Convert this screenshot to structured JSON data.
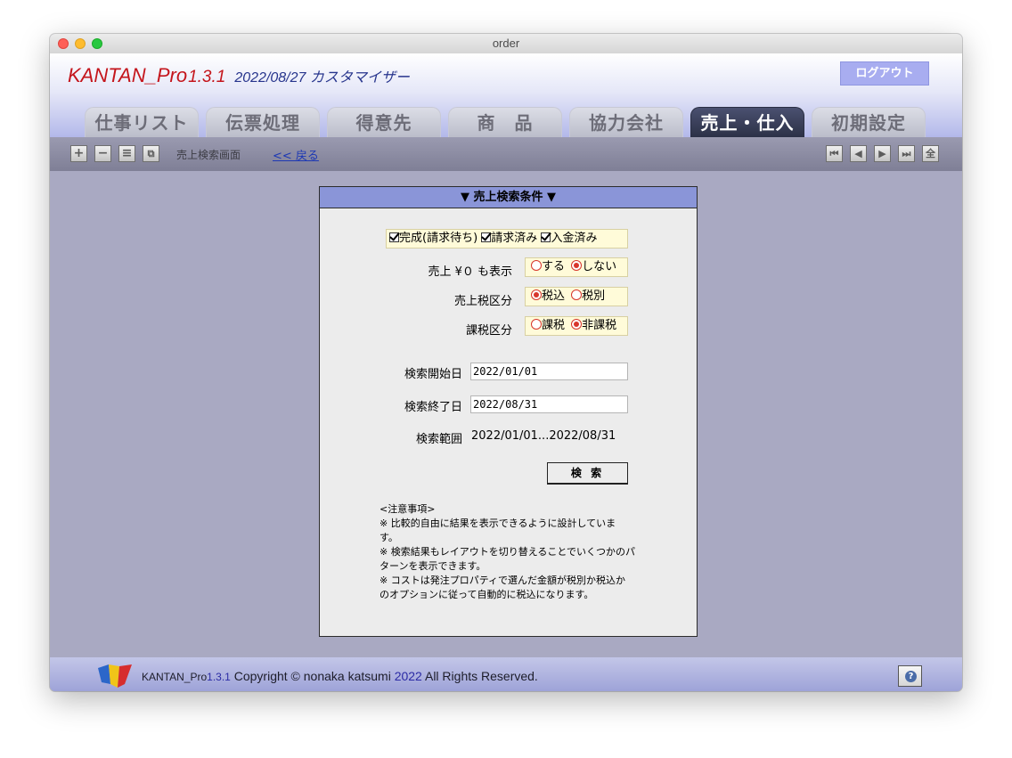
{
  "window": {
    "title": "order"
  },
  "header": {
    "app_name": "KANTAN_Pro",
    "app_version": "1.3.1",
    "subtitle": "2022/08/27 カスタマイザー",
    "logout_label": "ログアウト"
  },
  "tabs": [
    {
      "label": "仕事リスト",
      "active": false
    },
    {
      "label": "伝票処理",
      "active": false
    },
    {
      "label": "得意先",
      "active": false
    },
    {
      "label": "商　品",
      "active": false
    },
    {
      "label": "協力会社",
      "active": false
    },
    {
      "label": "売上・仕入",
      "active": true
    },
    {
      "label": "初期設定",
      "active": false
    }
  ],
  "toolbar": {
    "left_icons": [
      "plus-icon",
      "minus-icon",
      "list-icon",
      "duplicate-icon"
    ],
    "left_glyphs": [
      "+",
      "−",
      "≡",
      "⧉"
    ],
    "screen_name": "売上検索画面",
    "back_label": "<< 戻る",
    "nav_icons": [
      "first-record-icon",
      "prev-record-icon",
      "next-record-icon",
      "last-record-icon",
      "show-all-icon"
    ],
    "nav_glyphs": [
      "⏮",
      "◀",
      "▶",
      "⏭",
      "全"
    ]
  },
  "panel": {
    "title": "▼ 売上検索条件 ▼",
    "status_checks": [
      {
        "label": "完成(請求待ち)",
        "checked": true
      },
      {
        "label": "請求済み",
        "checked": true
      },
      {
        "label": "入金済み",
        "checked": true
      }
    ],
    "zero_sales": {
      "label": "売上 ¥０ も表示",
      "options": [
        "する",
        "しない"
      ],
      "selected": "しない"
    },
    "tax_type": {
      "label": "売上税区分",
      "options": [
        "税込",
        "税別"
      ],
      "selected": "税込"
    },
    "taxation": {
      "label": "課税区分",
      "options": [
        "課税",
        "非課税"
      ],
      "selected": "非課税"
    },
    "start_date": {
      "label": "検索開始日",
      "value": "2022/01/01"
    },
    "end_date": {
      "label": "検索終了日",
      "value": "2022/08/31"
    },
    "range": {
      "label": "検索範囲",
      "value": "2022/01/01...2022/08/31"
    },
    "search_label": "検 索",
    "notes": [
      "<注意事項>",
      "※ 比較的自由に結果を表示できるように設計していま",
      "す。",
      "※ 検索結果もレイアウトを切り替えることでいくつかのパ",
      "ターンを表示できます。",
      "※ コストは発注プロパティで選んだ金額が税別か税込か",
      "のオプションに従って自動的に税込になります。"
    ]
  },
  "footer": {
    "product": "KANTAN_Pro",
    "version": "1.3.1",
    "copyright": "Copyright © nonaka katsumi",
    "year": "2022",
    "rights": "All Rights Reserved.",
    "help_glyph": "?"
  },
  "colors": {
    "brand_red": "#c4151c",
    "header_blue": "#27358d",
    "panel_header": "#8a95d8",
    "content_bg": "#a9a9c2",
    "option_bg": "#fffbd9",
    "radio_red": "#d8352b"
  }
}
